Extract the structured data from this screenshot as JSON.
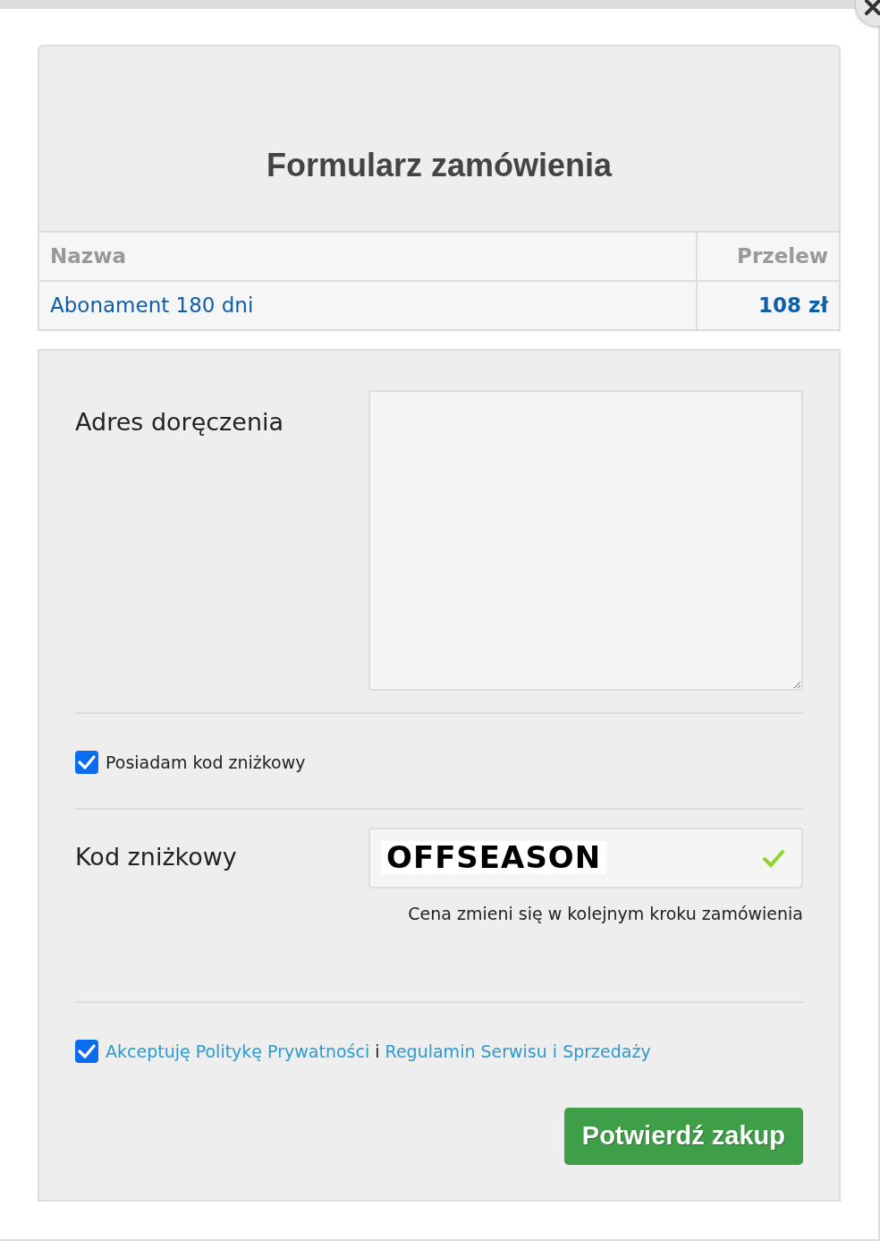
{
  "title": "Formularz zamówienia",
  "table": {
    "columns": [
      "Nazwa",
      "Przelew"
    ],
    "rows": [
      [
        "Abonament 180 dni",
        "108 zł"
      ]
    ]
  },
  "address": {
    "label": "Adres doręczenia"
  },
  "discount_toggle": {
    "label": "Posiadam kod zniżkowy",
    "checked": true
  },
  "discount_code": {
    "label": "Kod zniżkowy",
    "value": "OFFSEASON",
    "valid": true,
    "hint": "Cena zmieni się w kolejnym kroku zamówienia"
  },
  "consent": {
    "checked": true,
    "parts": [
      {
        "kind": "link",
        "text": "Akceptuję Politykę Prywatności"
      },
      {
        "kind": "text",
        "text": "i"
      },
      {
        "kind": "link",
        "text": "Regulamin Serwisu i Sprzedaży"
      }
    ]
  },
  "submit": "Potwierdź zakup"
}
